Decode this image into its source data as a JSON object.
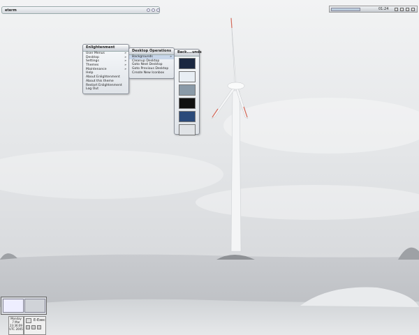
{
  "window": {
    "title": "eterm"
  },
  "topbar": {
    "clock": "01:24"
  },
  "menus": {
    "main": {
      "title": "Enlightenment",
      "items": [
        {
          "label": "User Menus",
          "arrow": "»"
        },
        {
          "label": "Desktop",
          "arrow": "»"
        },
        {
          "label": "Settings",
          "arrow": "»"
        },
        {
          "label": "Themes",
          "arrow": "»"
        },
        {
          "label": "Maintenance",
          "arrow": "»"
        },
        {
          "label": "Help",
          "arrow": ""
        },
        {
          "label": "About Enlightenment",
          "arrow": ""
        },
        {
          "label": "About this theme",
          "arrow": ""
        },
        {
          "label": "Restart Enlightenment",
          "arrow": ""
        },
        {
          "label": "Log Out",
          "arrow": ""
        }
      ]
    },
    "desktop_ops": {
      "title": "Desktop Operations",
      "items": [
        {
          "label": "Backgrounds",
          "arrow": "»"
        },
        {
          "label": "Cleanup Desktop",
          "arrow": ""
        },
        {
          "label": "Goto Next Desktop",
          "arrow": ""
        },
        {
          "label": "Goto Previous Desktop",
          "arrow": ""
        },
        {
          "label": "Create New Iconbox",
          "arrow": ""
        }
      ]
    },
    "backgrounds": {
      "title": "Back....unds",
      "thumbs": [
        {
          "name": "bg-thumb-night-blue"
        },
        {
          "name": "bg-thumb-white-logo"
        },
        {
          "name": "bg-thumb-grey-landscape"
        },
        {
          "name": "bg-thumb-dark-figure"
        },
        {
          "name": "bg-thumb-blue-sky"
        },
        {
          "name": "bg-thumb-windmill"
        }
      ]
    }
  },
  "clockbox": {
    "line1": "Monday",
    "line2": "7 Mar",
    "line3": "23:36:09",
    "line4": "UTC 2005"
  },
  "exec": {
    "label": "E-Exec"
  }
}
